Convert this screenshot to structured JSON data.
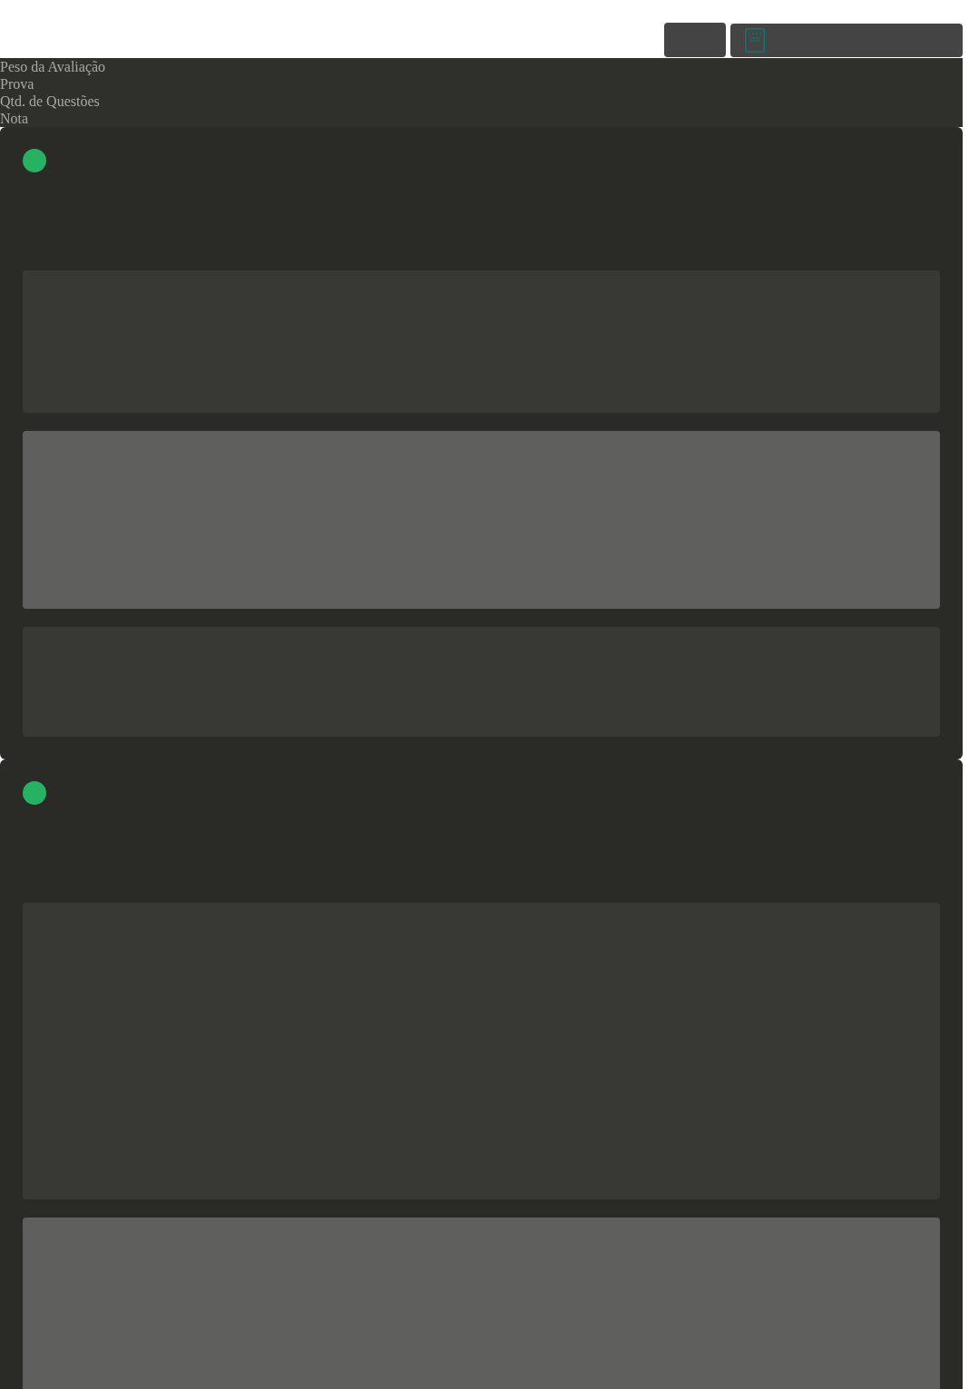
{
  "labels": [
    "Peso da Avaliação",
    "Prova",
    "Qtd. de Questões",
    "Nota"
  ],
  "cards": [
    {
      "blocks": [
        {
          "kind": "muted"
        },
        {
          "kind": "highlight"
        },
        {
          "kind": "muted"
        }
      ]
    },
    {
      "blocks": [
        {
          "kind": "muted"
        },
        {
          "kind": "highlight"
        }
      ]
    }
  ]
}
